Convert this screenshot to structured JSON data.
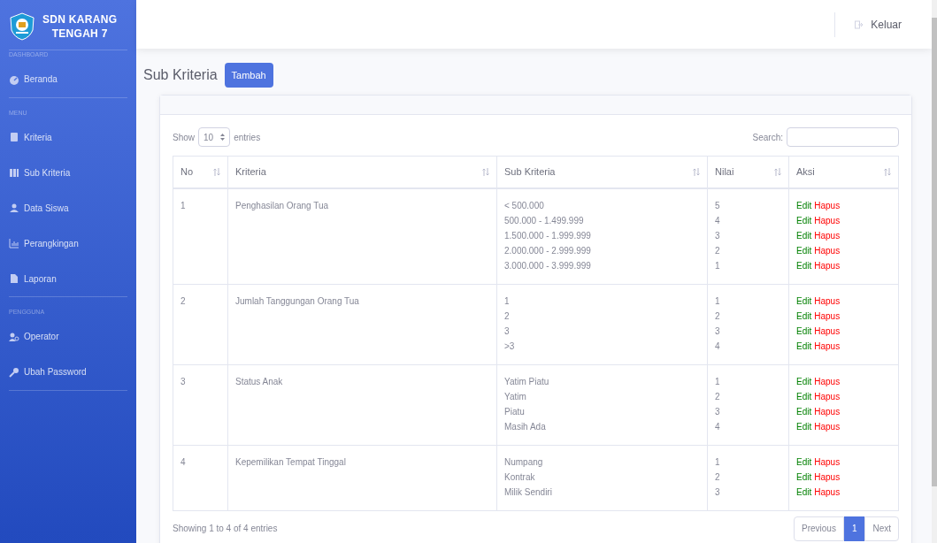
{
  "brand": {
    "line_1": "SDN KARANG",
    "line_2": "TENGAH 7"
  },
  "sidebar": {
    "sections": [
      {
        "heading": "DASHBOARD",
        "items": [
          {
            "label": "Beranda"
          }
        ]
      },
      {
        "heading": "MENU",
        "items": [
          {
            "label": "Kriteria"
          },
          {
            "label": "Sub Kriteria"
          },
          {
            "label": "Data Siswa"
          },
          {
            "label": "Perangkingan"
          },
          {
            "label": "Laporan"
          }
        ]
      },
      {
        "heading": "PENGGUNA",
        "items": [
          {
            "label": "Operator"
          },
          {
            "label": "Ubah Password"
          }
        ]
      }
    ]
  },
  "topbar": {
    "logout": "Keluar"
  },
  "page": {
    "title": "Sub Kriteria",
    "add_button": "Tambah"
  },
  "table_controls": {
    "show": "Show",
    "page_size": "10",
    "entries": "entries",
    "search_label": "Search:"
  },
  "table": {
    "columns": [
      "No",
      "Kriteria",
      "Sub Kriteria",
      "Nilai",
      "Aksi"
    ],
    "rows": [
      {
        "no": "1",
        "kriteria": "Penghasilan Orang Tua",
        "subs": [
          {
            "label": "< 500.000",
            "nilai": "5",
            "edit": "Edit",
            "delete": "Hapus"
          },
          {
            "label": "500.000 - 1.499.999",
            "nilai": "4",
            "edit": "Edit",
            "delete": "Hapus"
          },
          {
            "label": "1.500.000 - 1.999.999",
            "nilai": "3",
            "edit": "Edit",
            "delete": "Hapus"
          },
          {
            "label": "2.000.000 - 2.999.999",
            "nilai": "2",
            "edit": "Edit",
            "delete": "Hapus"
          },
          {
            "label": "3.000.000 - 3.999.999",
            "nilai": "1",
            "edit": "Edit",
            "delete": "Hapus"
          }
        ]
      },
      {
        "no": "2",
        "kriteria": "Jumlah Tanggungan Orang Tua",
        "subs": [
          {
            "label": "1",
            "nilai": "1",
            "edit": "Edit",
            "delete": "Hapus"
          },
          {
            "label": "2",
            "nilai": "2",
            "edit": "Edit",
            "delete": "Hapus"
          },
          {
            "label": "3",
            "nilai": "3",
            "edit": "Edit",
            "delete": "Hapus"
          },
          {
            "label": ">3",
            "nilai": "4",
            "edit": "Edit",
            "delete": "Hapus"
          }
        ]
      },
      {
        "no": "3",
        "kriteria": "Status Anak",
        "subs": [
          {
            "label": "Yatim Piatu",
            "nilai": "1",
            "edit": "Edit",
            "delete": "Hapus"
          },
          {
            "label": "Yatim",
            "nilai": "2",
            "edit": "Edit",
            "delete": "Hapus"
          },
          {
            "label": "Piatu",
            "nilai": "3",
            "edit": "Edit",
            "delete": "Hapus"
          },
          {
            "label": "Masih Ada",
            "nilai": "4",
            "edit": "Edit",
            "delete": "Hapus"
          }
        ]
      },
      {
        "no": "4",
        "kriteria": "Kepemilikan Tempat Tinggal",
        "subs": [
          {
            "label": "Numpang",
            "nilai": "1",
            "edit": "Edit",
            "delete": "Hapus"
          },
          {
            "label": "Kontrak",
            "nilai": "2",
            "edit": "Edit",
            "delete": "Hapus"
          },
          {
            "label": "Milik Sendiri",
            "nilai": "3",
            "edit": "Edit",
            "delete": "Hapus"
          }
        ]
      }
    ]
  },
  "footer": {
    "info": "Showing 1 to 4 of 4 entries",
    "pages": [
      {
        "label": "Previous",
        "selected": false
      },
      {
        "label": "1",
        "selected": true
      },
      {
        "label": "Next",
        "selected": false
      }
    ]
  }
}
